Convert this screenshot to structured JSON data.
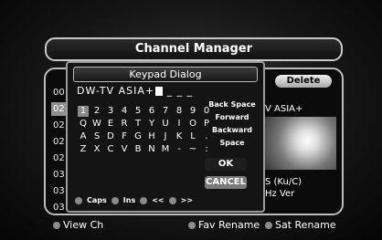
{
  "title": "Channel Manager",
  "panel": {
    "delete_label": "Delete",
    "channel_name": "V ASIA+",
    "satellite": "S (Ku/C)",
    "freq": "Hz Ver",
    "list": [
      "00",
      "02",
      "02",
      "02",
      "02",
      "03",
      "03",
      "03"
    ]
  },
  "dialog": {
    "title": "Keypad Dialog",
    "input": "DW-TV ASIA+",
    "rows": [
      [
        "1",
        "2",
        "3",
        "4",
        "5",
        "6",
        "7",
        "8",
        "9",
        "0"
      ],
      [
        "Q",
        "W",
        "E",
        "R",
        "T",
        "Y",
        "U",
        "I",
        "O",
        "P"
      ],
      [
        "A",
        "S",
        "D",
        "F",
        "G",
        "H",
        "J",
        "K",
        "L",
        "."
      ],
      [
        "Z",
        "X",
        "C",
        "V",
        "B",
        "N",
        "M",
        "-",
        "~",
        ":"
      ]
    ],
    "fn": [
      "Back Space",
      "Forward",
      "Backward",
      "Space"
    ],
    "ok": "OK",
    "cancel": "CANCEL",
    "legend": [
      "Caps",
      "Ins",
      "<<",
      ">>"
    ]
  },
  "footer": {
    "view": "View Ch",
    "fav": "Fav Rename",
    "sat": "Sat Rename"
  }
}
